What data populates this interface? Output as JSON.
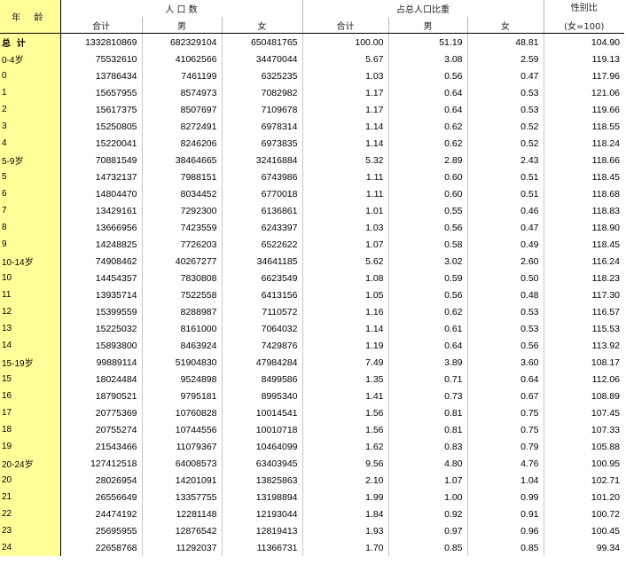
{
  "headers": {
    "age": "年  龄",
    "population": "人  口  数",
    "share": "占总人口比重",
    "sex_ratio": "性别比",
    "sex_ratio_note": "(女=100)",
    "total": "合计",
    "male": "男",
    "female": "女"
  },
  "rows": [
    {
      "age": "总  计",
      "total": "1332810869",
      "male": "682329104",
      "female": "650481765",
      "pt": "100.00",
      "pm": "51.19",
      "pf": "48.81",
      "sr": "104.90"
    },
    {
      "age": "0-4岁",
      "total": "75532610",
      "male": "41062566",
      "female": "34470044",
      "pt": "5.67",
      "pm": "3.08",
      "pf": "2.59",
      "sr": "119.13"
    },
    {
      "age": "0",
      "total": "13786434",
      "male": "7461199",
      "female": "6325235",
      "pt": "1.03",
      "pm": "0.56",
      "pf": "0.47",
      "sr": "117.96"
    },
    {
      "age": "1",
      "total": "15657955",
      "male": "8574973",
      "female": "7082982",
      "pt": "1.17",
      "pm": "0.64",
      "pf": "0.53",
      "sr": "121.06"
    },
    {
      "age": "2",
      "total": "15617375",
      "male": "8507697",
      "female": "7109678",
      "pt": "1.17",
      "pm": "0.64",
      "pf": "0.53",
      "sr": "119.66"
    },
    {
      "age": "3",
      "total": "15250805",
      "male": "8272491",
      "female": "6978314",
      "pt": "1.14",
      "pm": "0.62",
      "pf": "0.52",
      "sr": "118.55"
    },
    {
      "age": "4",
      "total": "15220041",
      "male": "8246206",
      "female": "6973835",
      "pt": "1.14",
      "pm": "0.62",
      "pf": "0.52",
      "sr": "118.24"
    },
    {
      "age": "5-9岁",
      "total": "70881549",
      "male": "38464665",
      "female": "32416884",
      "pt": "5.32",
      "pm": "2.89",
      "pf": "2.43",
      "sr": "118.66"
    },
    {
      "age": "5",
      "total": "14732137",
      "male": "7988151",
      "female": "6743986",
      "pt": "1.11",
      "pm": "0.60",
      "pf": "0.51",
      "sr": "118.45"
    },
    {
      "age": "6",
      "total": "14804470",
      "male": "8034452",
      "female": "6770018",
      "pt": "1.11",
      "pm": "0.60",
      "pf": "0.51",
      "sr": "118.68"
    },
    {
      "age": "7",
      "total": "13429161",
      "male": "7292300",
      "female": "6136861",
      "pt": "1.01",
      "pm": "0.55",
      "pf": "0.46",
      "sr": "118.83"
    },
    {
      "age": "8",
      "total": "13666956",
      "male": "7423559",
      "female": "6243397",
      "pt": "1.03",
      "pm": "0.56",
      "pf": "0.47",
      "sr": "118.90"
    },
    {
      "age": "9",
      "total": "14248825",
      "male": "7726203",
      "female": "6522622",
      "pt": "1.07",
      "pm": "0.58",
      "pf": "0.49",
      "sr": "118.45"
    },
    {
      "age": "10-14岁",
      "total": "74908462",
      "male": "40267277",
      "female": "34641185",
      "pt": "5.62",
      "pm": "3.02",
      "pf": "2.60",
      "sr": "116.24"
    },
    {
      "age": "10",
      "total": "14454357",
      "male": "7830808",
      "female": "6623549",
      "pt": "1.08",
      "pm": "0.59",
      "pf": "0.50",
      "sr": "118.23"
    },
    {
      "age": "11",
      "total": "13935714",
      "male": "7522558",
      "female": "6413156",
      "pt": "1.05",
      "pm": "0.56",
      "pf": "0.48",
      "sr": "117.30"
    },
    {
      "age": "12",
      "total": "15399559",
      "male": "8288987",
      "female": "7110572",
      "pt": "1.16",
      "pm": "0.62",
      "pf": "0.53",
      "sr": "116.57"
    },
    {
      "age": "13",
      "total": "15225032",
      "male": "8161000",
      "female": "7064032",
      "pt": "1.14",
      "pm": "0.61",
      "pf": "0.53",
      "sr": "115.53"
    },
    {
      "age": "14",
      "total": "15893800",
      "male": "8463924",
      "female": "7429876",
      "pt": "1.19",
      "pm": "0.64",
      "pf": "0.56",
      "sr": "113.92"
    },
    {
      "age": "15-19岁",
      "total": "99889114",
      "male": "51904830",
      "female": "47984284",
      "pt": "7.49",
      "pm": "3.89",
      "pf": "3.60",
      "sr": "108.17"
    },
    {
      "age": "15",
      "total": "18024484",
      "male": "9524898",
      "female": "8499586",
      "pt": "1.35",
      "pm": "0.71",
      "pf": "0.64",
      "sr": "112.06"
    },
    {
      "age": "16",
      "total": "18790521",
      "male": "9795181",
      "female": "8995340",
      "pt": "1.41",
      "pm": "0.73",
      "pf": "0.67",
      "sr": "108.89"
    },
    {
      "age": "17",
      "total": "20775369",
      "male": "10760828",
      "female": "10014541",
      "pt": "1.56",
      "pm": "0.81",
      "pf": "0.75",
      "sr": "107.45"
    },
    {
      "age": "18",
      "total": "20755274",
      "male": "10744556",
      "female": "10010718",
      "pt": "1.56",
      "pm": "0.81",
      "pf": "0.75",
      "sr": "107.33"
    },
    {
      "age": "19",
      "total": "21543466",
      "male": "11079367",
      "female": "10464099",
      "pt": "1.62",
      "pm": "0.83",
      "pf": "0.79",
      "sr": "105.88"
    },
    {
      "age": "20-24岁",
      "total": "127412518",
      "male": "64008573",
      "female": "63403945",
      "pt": "9.56",
      "pm": "4.80",
      "pf": "4.76",
      "sr": "100.95"
    },
    {
      "age": "20",
      "total": "28026954",
      "male": "14201091",
      "female": "13825863",
      "pt": "2.10",
      "pm": "1.07",
      "pf": "1.04",
      "sr": "102.71"
    },
    {
      "age": "21",
      "total": "26556649",
      "male": "13357755",
      "female": "13198894",
      "pt": "1.99",
      "pm": "1.00",
      "pf": "0.99",
      "sr": "101.20"
    },
    {
      "age": "22",
      "total": "24474192",
      "male": "12281148",
      "female": "12193044",
      "pt": "1.84",
      "pm": "0.92",
      "pf": "0.91",
      "sr": "100.72"
    },
    {
      "age": "23",
      "total": "25695955",
      "male": "12876542",
      "female": "12819413",
      "pt": "1.93",
      "pm": "0.97",
      "pf": "0.96",
      "sr": "100.45"
    },
    {
      "age": "24",
      "total": "22658768",
      "male": "11292037",
      "female": "11366731",
      "pt": "1.70",
      "pm": "0.85",
      "pf": "0.85",
      "sr": "99.34"
    }
  ]
}
